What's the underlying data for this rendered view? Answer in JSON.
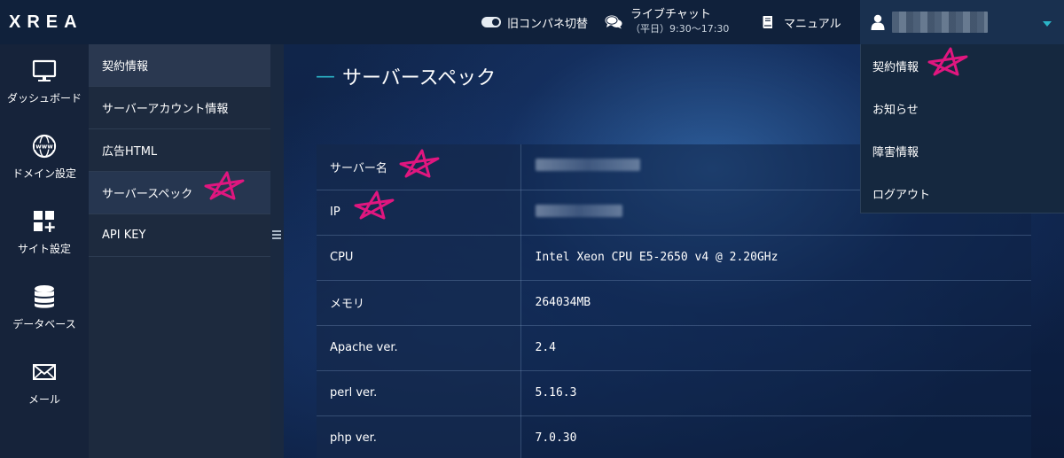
{
  "topbar": {
    "logo": "XREA",
    "old_panel_toggle": "旧コンパネ切替",
    "live_chat": "ライブチャット",
    "live_chat_hours": "（平日）9:30～17:30",
    "manual": "マニュアル"
  },
  "user_menu": {
    "items": [
      "契約情報",
      "お知らせ",
      "障害情報",
      "ログアウト"
    ]
  },
  "icon_nav": {
    "items": [
      {
        "label": "ダッシュボード",
        "icon": "monitor-icon"
      },
      {
        "label": "ドメイン設定",
        "icon": "globe-www-icon"
      },
      {
        "label": "サイト設定",
        "icon": "grid-plus-icon"
      },
      {
        "label": "データベース",
        "icon": "database-icon"
      },
      {
        "label": "メール",
        "icon": "envelope-icon"
      }
    ]
  },
  "sub_nav": {
    "items": [
      "契約情報",
      "サーバーアカウント情報",
      "広告HTML",
      "サーバースペック",
      "API KEY"
    ]
  },
  "main": {
    "title": "サーバースペック",
    "rows": [
      {
        "key": "サーバー名",
        "value": ""
      },
      {
        "key": "IP",
        "value": ""
      },
      {
        "key": "CPU",
        "value": "Intel Xeon CPU E5-2650 v4 @ 2.20GHz"
      },
      {
        "key": "メモリ",
        "value": "264034MB"
      },
      {
        "key": "Apache ver.",
        "value": "2.4"
      },
      {
        "key": "perl ver.",
        "value": "5.16.3"
      },
      {
        "key": "php ver.",
        "value": "7.0.30"
      }
    ]
  },
  "colors": {
    "accent": "#2bb5c8",
    "annotation": "#e0167f"
  }
}
